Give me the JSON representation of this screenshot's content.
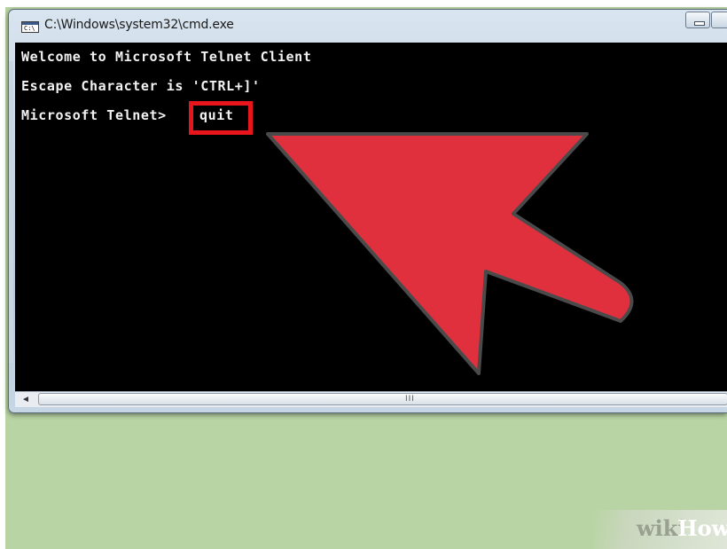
{
  "window": {
    "title": "C:\\Windows\\system32\\cmd.exe",
    "icon": "cmd-icon",
    "icon_text": "C:\\"
  },
  "console": {
    "lines": [
      "Welcome to Microsoft Telnet Client",
      "Escape Character is 'CTRL+]'",
      "Microsoft Telnet> "
    ],
    "command": "quit",
    "text_color": "#f2f2f2",
    "background": "#000000"
  },
  "highlight": {
    "target": "quit",
    "color": "#e8151d"
  },
  "arrow": {
    "icon": "arrow-pointer-icon",
    "color": "#e0303e"
  },
  "scrollbar": {
    "left_arrow": "◄",
    "thumb_grip": "III"
  },
  "watermark": {
    "wiki": "wiki",
    "how": "How"
  },
  "colors": {
    "desktop": "#b9d4a4",
    "window_frame": "#c7d6e4"
  }
}
